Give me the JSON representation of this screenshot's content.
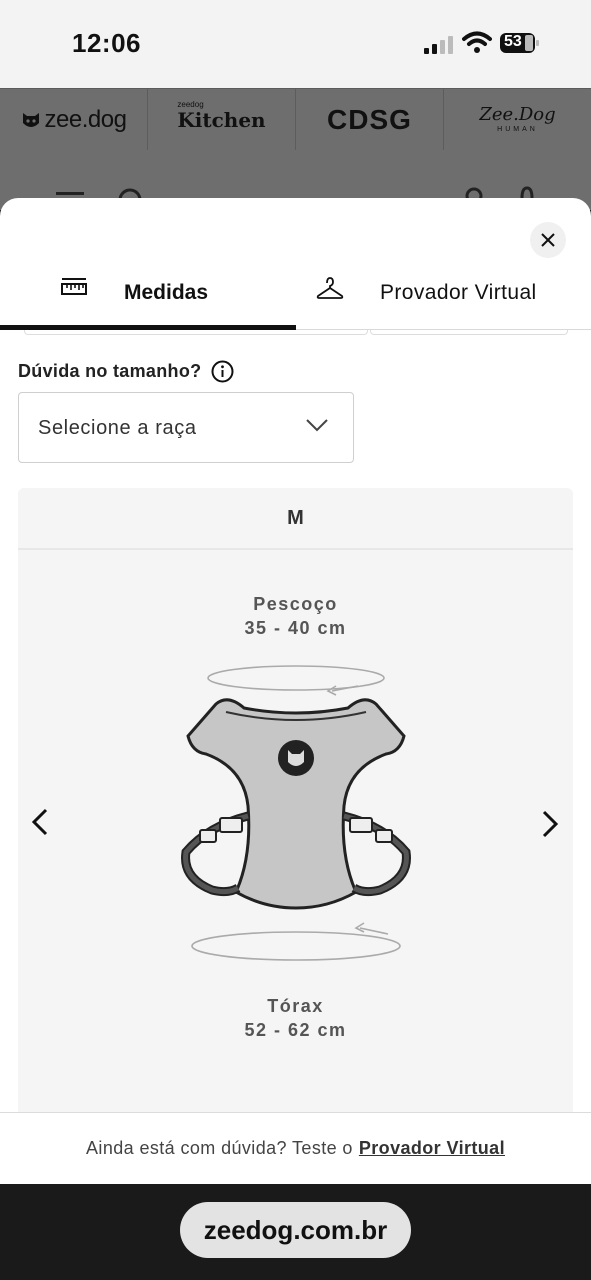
{
  "status_bar": {
    "time": "12:06",
    "battery": "53"
  },
  "brands": {
    "zeedog": "zee.dog",
    "kitchen_top": "zeedog",
    "kitchen": "Kitchen",
    "cdsg": "CDSG",
    "human_top": "Zee.Dog",
    "human": "HUMAN"
  },
  "tabs": [
    {
      "label": "Medidas",
      "icon": "ruler-icon",
      "active": true
    },
    {
      "label": "Provador Virtual",
      "icon": "hanger-icon",
      "active": false
    }
  ],
  "size_help": {
    "question": "Dúvida no tamanho?",
    "select_value": "Selecione a raça"
  },
  "size_card": {
    "size": "M",
    "neck_label": "Pescoço",
    "neck_range": "35 - 40 cm",
    "chest_label": "Tórax",
    "chest_range": "52 - 62 cm"
  },
  "footer": {
    "text": "Ainda está com dúvida? Teste o",
    "link": "Provador Virtual"
  },
  "url": "zeedog.com.br",
  "colors": {
    "accent": "#111111",
    "overlay": "#6e6e6e",
    "card_bg": "#f5f5f5"
  }
}
